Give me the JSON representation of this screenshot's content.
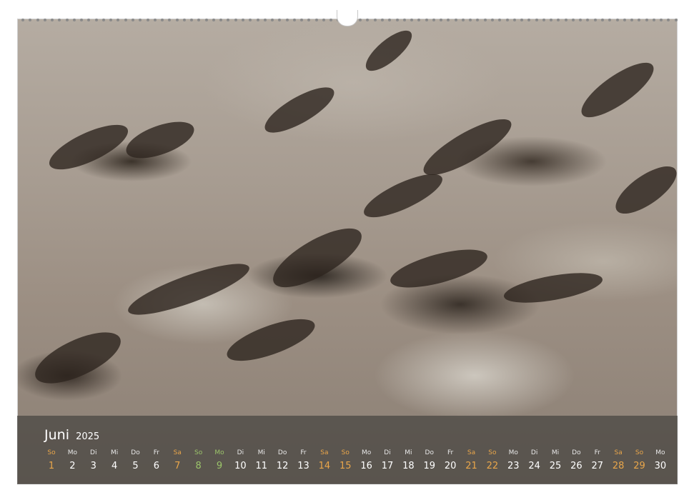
{
  "calendar": {
    "month": "Juni",
    "year": "2025",
    "colors": {
      "weekend": "#e9a64a",
      "holiday": "#9bc46a",
      "weekday": "#ffffff"
    },
    "days": [
      {
        "wd": "So",
        "num": "1",
        "type": "we"
      },
      {
        "wd": "Mo",
        "num": "2",
        "type": "wd"
      },
      {
        "wd": "Di",
        "num": "3",
        "type": "wd"
      },
      {
        "wd": "Mi",
        "num": "4",
        "type": "wd"
      },
      {
        "wd": "Do",
        "num": "5",
        "type": "wd"
      },
      {
        "wd": "Fr",
        "num": "6",
        "type": "wd"
      },
      {
        "wd": "Sa",
        "num": "7",
        "type": "we"
      },
      {
        "wd": "So",
        "num": "8",
        "type": "hol"
      },
      {
        "wd": "Mo",
        "num": "9",
        "type": "hol"
      },
      {
        "wd": "Di",
        "num": "10",
        "type": "wd"
      },
      {
        "wd": "Mi",
        "num": "11",
        "type": "wd"
      },
      {
        "wd": "Do",
        "num": "12",
        "type": "wd"
      },
      {
        "wd": "Fr",
        "num": "13",
        "type": "wd"
      },
      {
        "wd": "Sa",
        "num": "14",
        "type": "we"
      },
      {
        "wd": "So",
        "num": "15",
        "type": "we"
      },
      {
        "wd": "Mo",
        "num": "16",
        "type": "wd"
      },
      {
        "wd": "Di",
        "num": "17",
        "type": "wd"
      },
      {
        "wd": "Mi",
        "num": "18",
        "type": "wd"
      },
      {
        "wd": "Do",
        "num": "19",
        "type": "wd"
      },
      {
        "wd": "Fr",
        "num": "20",
        "type": "wd"
      },
      {
        "wd": "Sa",
        "num": "21",
        "type": "we"
      },
      {
        "wd": "So",
        "num": "22",
        "type": "we"
      },
      {
        "wd": "Mo",
        "num": "23",
        "type": "wd"
      },
      {
        "wd": "Di",
        "num": "24",
        "type": "wd"
      },
      {
        "wd": "Mi",
        "num": "25",
        "type": "wd"
      },
      {
        "wd": "Do",
        "num": "26",
        "type": "wd"
      },
      {
        "wd": "Fr",
        "num": "27",
        "type": "wd"
      },
      {
        "wd": "Sa",
        "num": "28",
        "type": "we"
      },
      {
        "wd": "So",
        "num": "29",
        "type": "we"
      },
      {
        "wd": "Mo",
        "num": "30",
        "type": "wd"
      }
    ]
  }
}
